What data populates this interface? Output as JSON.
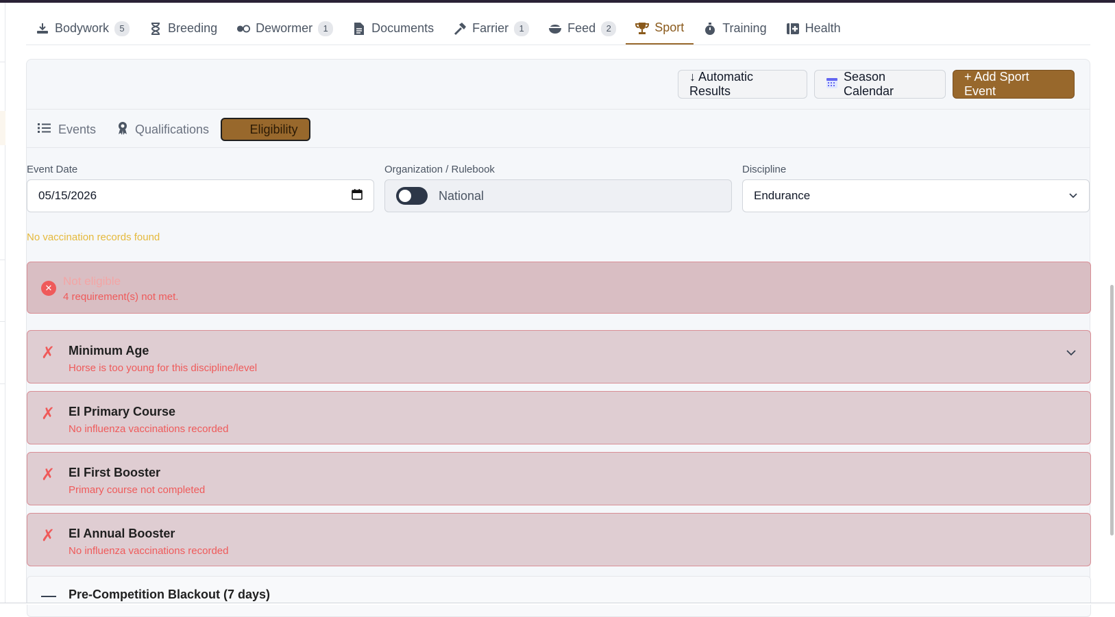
{
  "tabs": [
    {
      "label": "Bodywork",
      "badge": "5",
      "icon": "massage-icon"
    },
    {
      "label": "Breeding",
      "badge": "",
      "icon": "hourglass-icon"
    },
    {
      "label": "Dewormer",
      "badge": "1",
      "icon": "pills-icon"
    },
    {
      "label": "Documents",
      "badge": "",
      "icon": "document-icon"
    },
    {
      "label": "Farrier",
      "badge": "1",
      "icon": "hammer-icon"
    },
    {
      "label": "Feed",
      "badge": "2",
      "icon": "bowl-icon"
    },
    {
      "label": "Sport",
      "badge": "",
      "icon": "trophy-icon",
      "active": true
    },
    {
      "label": "Training",
      "badge": "",
      "icon": "stopwatch-icon"
    },
    {
      "label": "Health",
      "badge": "",
      "icon": "medical-kit-icon"
    }
  ],
  "toolbar": {
    "automatic_results": "↓ Automatic Results",
    "season_calendar": "Season Calendar",
    "add_sport_event": "+ Add Sport Event"
  },
  "subtabs": {
    "events": "Events",
    "qualifications": "Qualifications",
    "eligibility": "Eligibility"
  },
  "filters": {
    "event_date_label": "Event Date",
    "event_date_value": "05/15/2026",
    "organization_label": "Organization / Rulebook",
    "organization_value": "National",
    "discipline_label": "Discipline",
    "discipline_value": "Endurance"
  },
  "warning": "No vaccination records found",
  "status": {
    "title": "Not eligible",
    "detail": "4 requirement(s) not met."
  },
  "requirements": [
    {
      "title": "Minimum Age",
      "detail": "Horse is too young for this discipline/level",
      "mark": "✗"
    },
    {
      "title": "EI Primary Course",
      "detail": "No influenza vaccinations recorded",
      "mark": "✗"
    },
    {
      "title": "EI First Booster",
      "detail": "Primary course not completed",
      "mark": "✗"
    },
    {
      "title": "EI Annual Booster",
      "detail": "No influenza vaccinations recorded",
      "mark": "✗"
    }
  ],
  "pending_requirement": {
    "title": "Pre-Competition Blackout (7 days)"
  },
  "colors": {
    "brand": "#98682c",
    "error": "#ef5a5a",
    "warning": "#e5b93c"
  }
}
